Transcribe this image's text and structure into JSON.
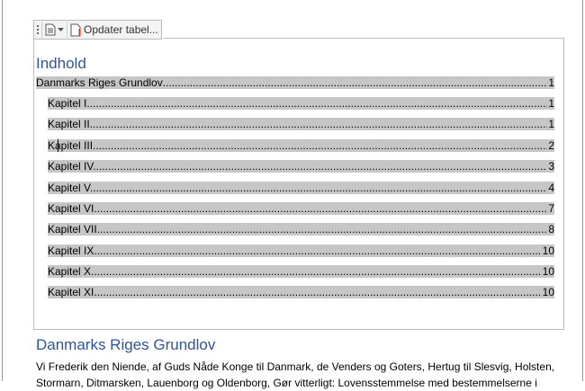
{
  "toolbar": {
    "update_label": "Opdater tabel...",
    "icons": [
      "drag-handle-icon",
      "document-icon",
      "chevron-down-icon",
      "update-doc-icon"
    ]
  },
  "toc": {
    "heading": "Indhold",
    "entries": [
      {
        "title": "Danmarks Riges Grundlov",
        "page": "1",
        "level": 1
      },
      {
        "title": "Kapitel I.",
        "page": "1",
        "level": 2
      },
      {
        "title": "Kapitel II.",
        "page": "1",
        "level": 2
      },
      {
        "title": "Kapitel III.",
        "page": "2",
        "level": 2
      },
      {
        "title": "Kapitel IV. ",
        "page": "3",
        "level": 2
      },
      {
        "title": "Kapitel V. ",
        "page": "4",
        "level": 2
      },
      {
        "title": "Kapitel VI. ",
        "page": "7",
        "level": 2
      },
      {
        "title": "Kapitel VII. ",
        "page": "8",
        "level": 2
      },
      {
        "title": "Kapitel IX.",
        "page": "10",
        "level": 2
      },
      {
        "title": "Kapitel X.",
        "page": "10",
        "level": 2
      },
      {
        "title": "Kapitel XI.",
        "page": "10",
        "level": 2
      }
    ]
  },
  "body": {
    "heading": "Danmarks Riges Grundlov",
    "line1": "Vi Frederik den Niende, af Guds Nåde Konge til Danmark, de Venders og Goters, Hertug til Slesvig, Holsten,",
    "line2": "Stormarn, Ditmarsken, Lauenborg og Oldenborg, Gør vitterligt: Lovensstemmelse med bestemmelserne i"
  },
  "colors": {
    "heading": "#2f5596",
    "field_shading": "#c6c6c6"
  }
}
